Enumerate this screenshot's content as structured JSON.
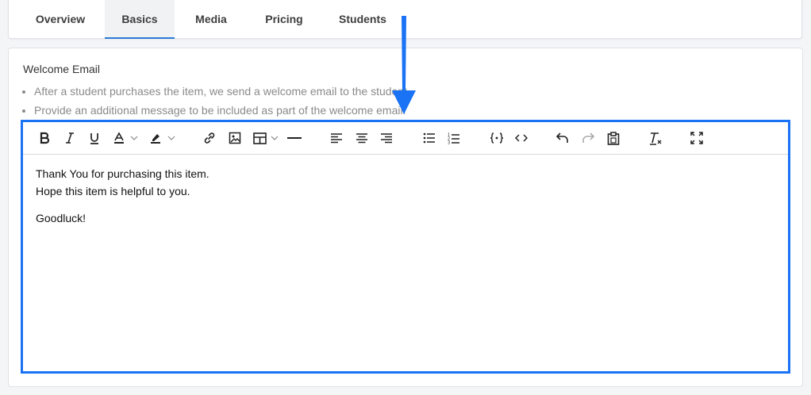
{
  "tabs": [
    {
      "label": "Overview"
    },
    {
      "label": "Basics"
    },
    {
      "label": "Media"
    },
    {
      "label": "Pricing"
    },
    {
      "label": "Students"
    }
  ],
  "active_tab": "Basics",
  "section": {
    "title": "Welcome Email",
    "bullets": [
      "After a student purchases the item, we send a welcome email to the student.",
      "Provide an additional message to be included as part of the welcome email."
    ]
  },
  "toolbar": {
    "tools": [
      "bold-icon",
      "italic-icon",
      "underline-icon",
      "text-color-icon",
      "highlight-icon",
      "link-icon",
      "image-icon",
      "table-icon",
      "horizontal-rule-icon",
      "align-left-icon",
      "align-center-icon",
      "align-right-icon",
      "bullet-list-icon",
      "numbered-list-icon",
      "merge-tag-icon",
      "code-icon",
      "undo-icon",
      "redo-icon",
      "paste-icon",
      "clear-format-icon",
      "fullscreen-icon"
    ]
  },
  "editor": {
    "line1": "Thank You for purchasing this item.",
    "line2": "Hope this item is helpful to you.",
    "line3": "Goodluck!"
  },
  "colors": {
    "editor_border": "#1a73f5",
    "arrow": "#1a73f5",
    "active_tab_underline": "#2b7ad8"
  }
}
